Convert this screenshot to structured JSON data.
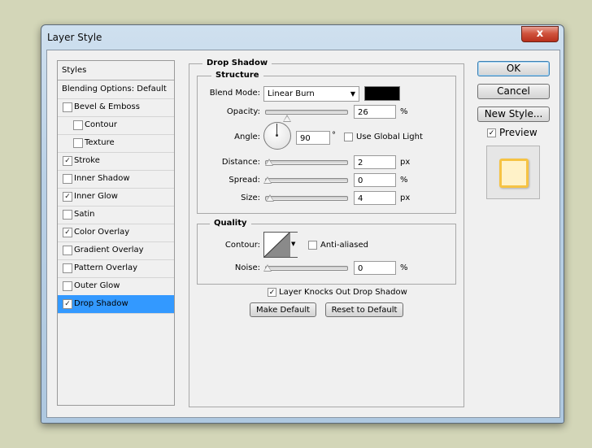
{
  "window": {
    "title": "Layer Style",
    "close_label": "x"
  },
  "sidebar": {
    "items": [
      {
        "label": "Styles",
        "checkbox": false,
        "checked": false,
        "selected": false
      },
      {
        "label": "Blending Options: Default",
        "checkbox": false,
        "checked": false,
        "selected": false
      },
      {
        "label": "Bevel & Emboss",
        "checkbox": true,
        "checked": false,
        "selected": false
      },
      {
        "label": "Contour",
        "checkbox": true,
        "checked": false,
        "selected": false,
        "indent": true
      },
      {
        "label": "Texture",
        "checkbox": true,
        "checked": false,
        "selected": false,
        "indent": true
      },
      {
        "label": "Stroke",
        "checkbox": true,
        "checked": true,
        "selected": false
      },
      {
        "label": "Inner Shadow",
        "checkbox": true,
        "checked": false,
        "selected": false
      },
      {
        "label": "Inner Glow",
        "checkbox": true,
        "checked": true,
        "selected": false
      },
      {
        "label": "Satin",
        "checkbox": true,
        "checked": false,
        "selected": false
      },
      {
        "label": "Color Overlay",
        "checkbox": true,
        "checked": true,
        "selected": false
      },
      {
        "label": "Gradient Overlay",
        "checkbox": true,
        "checked": false,
        "selected": false
      },
      {
        "label": "Pattern Overlay",
        "checkbox": true,
        "checked": false,
        "selected": false
      },
      {
        "label": "Outer Glow",
        "checkbox": true,
        "checked": false,
        "selected": false
      },
      {
        "label": "Drop Shadow",
        "checkbox": true,
        "checked": true,
        "selected": true
      }
    ]
  },
  "drop_shadow": {
    "title": "Drop Shadow",
    "structure": {
      "title": "Structure",
      "blend_mode_label": "Blend Mode:",
      "blend_mode_value": "Linear Burn",
      "shadow_color": "#000000",
      "opacity_label": "Opacity:",
      "opacity_value": "26",
      "opacity_unit": "%",
      "opacity_level": 0.26,
      "angle_label": "Angle:",
      "angle_value": "90",
      "angle_unit": "°",
      "use_global_light_label": "Use Global Light",
      "use_global_light_checked": false,
      "distance_label": "Distance:",
      "distance_value": "2",
      "distance_unit": "px",
      "spread_label": "Spread:",
      "spread_value": "0",
      "spread_unit": "%",
      "size_label": "Size:",
      "size_value": "4",
      "size_unit": "px"
    },
    "quality": {
      "title": "Quality",
      "contour_label": "Contour:",
      "anti_aliased_label": "Anti-aliased",
      "anti_aliased_checked": false,
      "noise_label": "Noise:",
      "noise_value": "0",
      "noise_unit": "%"
    },
    "layer_knocks_out_label": "Layer Knocks Out Drop Shadow",
    "layer_knocks_out_checked": true,
    "make_default_label": "Make Default",
    "reset_default_label": "Reset to Default"
  },
  "actions": {
    "ok_label": "OK",
    "cancel_label": "Cancel",
    "new_style_label": "New Style...",
    "preview_label": "Preview",
    "preview_checked": true,
    "preview_fill_color": "#fff2c8",
    "preview_stroke_color": "#f6c343"
  }
}
